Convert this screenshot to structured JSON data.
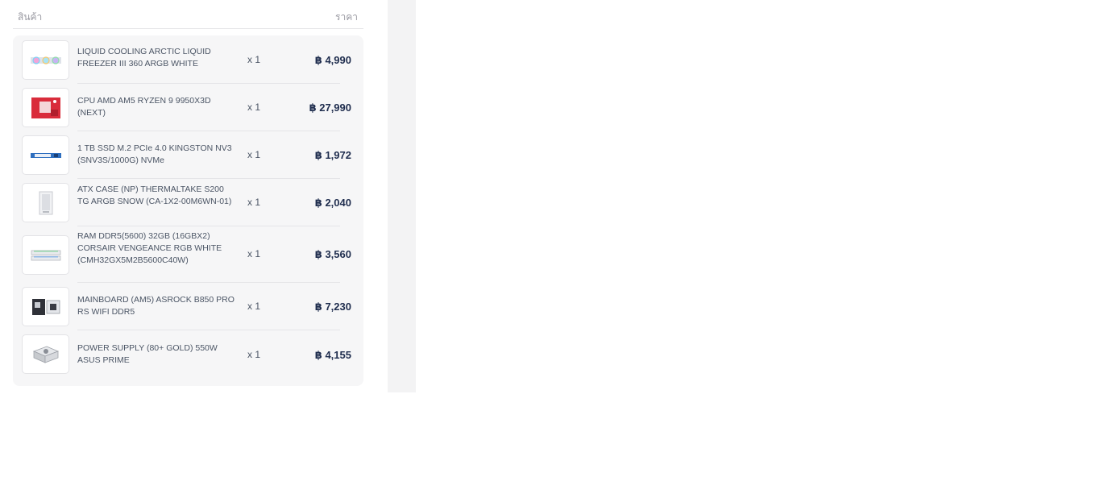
{
  "header": {
    "product_label": "สินค้า",
    "price_label": "ราคา"
  },
  "items": [
    {
      "name": "LIQUID COOLING ARCTIC LIQUID FREEZER III 360 ARGB WHITE",
      "qty": "x 1",
      "price": "฿ 4,990",
      "icon": "liquid-cooler-icon"
    },
    {
      "name": "CPU AMD AM5 RYZEN 9 9950X3D (NEXT)",
      "qty": "x 1",
      "price": "฿ 27,990",
      "icon": "cpu-box-icon"
    },
    {
      "name": "1 TB SSD M.2 PCIe 4.0 KINGSTON NV3 (SNV3S/1000G) NVMe",
      "qty": "x 1",
      "price": "฿ 1,972",
      "icon": "ssd-icon"
    },
    {
      "name": "ATX CASE (NP) THERMALTAKE S200 TG ARGB SNOW (CA-1X2-00M6WN-01)",
      "qty": "x 1",
      "price": "฿ 2,040",
      "icon": "pc-case-icon"
    },
    {
      "name": "RAM DDR5(5600) 32GB (16GBX2) CORSAIR VENGEANCE RGB WHITE (CMH32GX5M2B5600C40W)",
      "qty": "x 1",
      "price": "฿ 3,560",
      "icon": "ram-icon"
    },
    {
      "name": "MAINBOARD (AM5) ASROCK B850 PRO RS WIFI DDR5",
      "qty": "x 1",
      "price": "฿ 7,230",
      "icon": "motherboard-icon"
    },
    {
      "name": "POWER SUPPLY (80+ GOLD) 550W ASUS PRIME",
      "qty": "x 1",
      "price": "฿ 4,155",
      "icon": "power-supply-icon"
    }
  ]
}
